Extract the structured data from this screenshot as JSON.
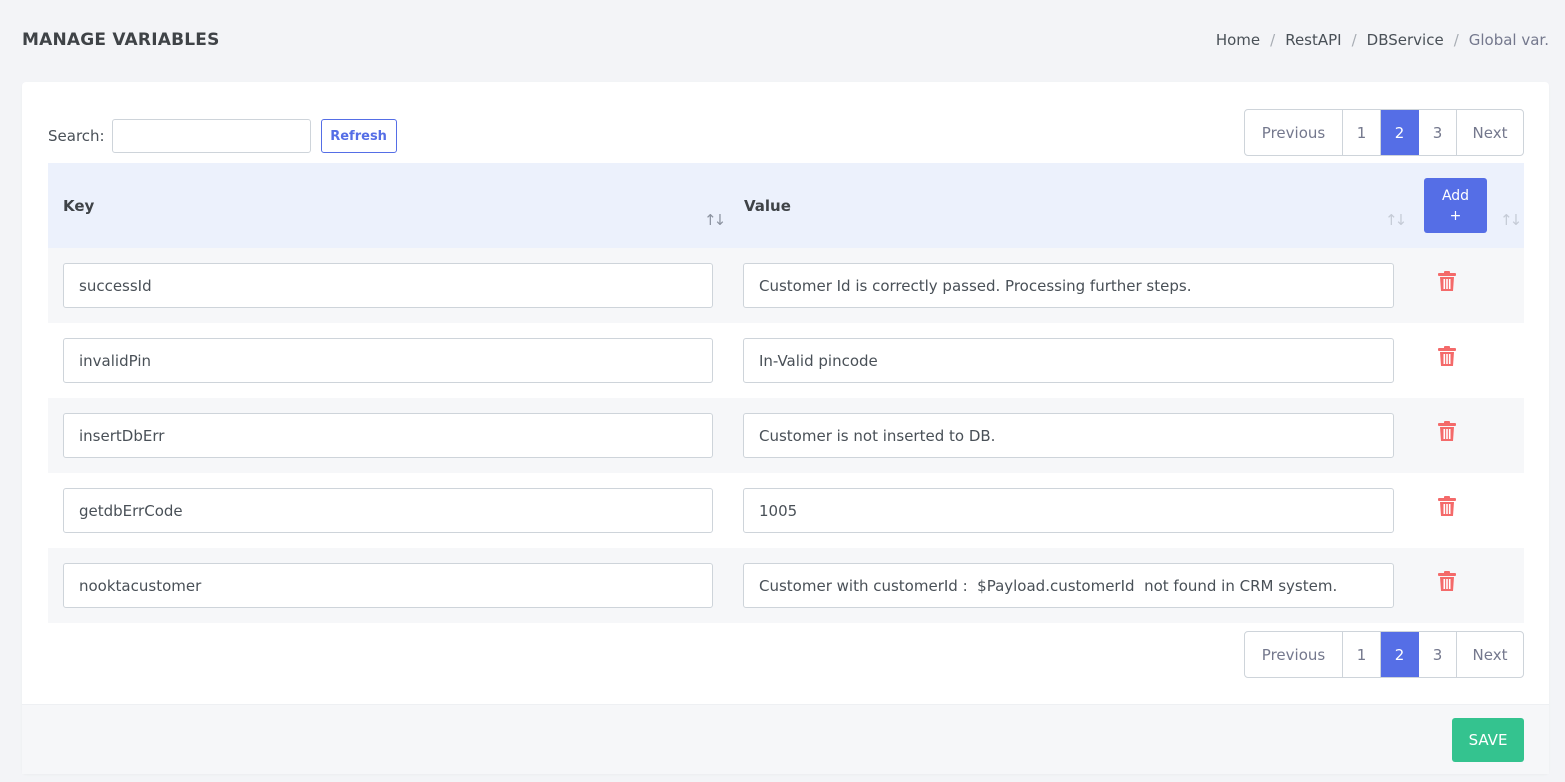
{
  "header": {
    "title": "MANAGE VARIABLES",
    "breadcrumb": [
      "Home",
      "RestAPI",
      "DBService",
      "Global var."
    ],
    "separator": "/"
  },
  "toolbar": {
    "search_label": "Search:",
    "search_value": "",
    "refresh_label": "Refresh"
  },
  "pagination": {
    "previous_label": "Previous",
    "next_label": "Next",
    "pages": [
      "1",
      "2",
      "3"
    ],
    "active_page": "2"
  },
  "table": {
    "columns": {
      "key": "Key",
      "value": "Value"
    },
    "sort_icon": "↑↓",
    "add_label": "Add\n+",
    "rows": [
      {
        "key": "successId",
        "value": "Customer Id is correctly passed. Processing further steps."
      },
      {
        "key": "invalidPin",
        "value": "In-Valid pincode"
      },
      {
        "key": "insertDbErr",
        "value": "Customer is not inserted to DB."
      },
      {
        "key": "getdbErrCode",
        "value": "1005"
      },
      {
        "key": "nooktacustomer",
        "value": "Customer with customerId :  $Payload.customerId  not found in CRM system."
      }
    ]
  },
  "footer": {
    "save_label": "SAVE"
  },
  "colors": {
    "primary": "#556ee6",
    "success": "#34c38f",
    "danger": "#f46a6a",
    "header_bg": "#ecf1fc"
  },
  "icons": {
    "delete": "trash-icon",
    "sort": "sort-arrows-icon"
  }
}
